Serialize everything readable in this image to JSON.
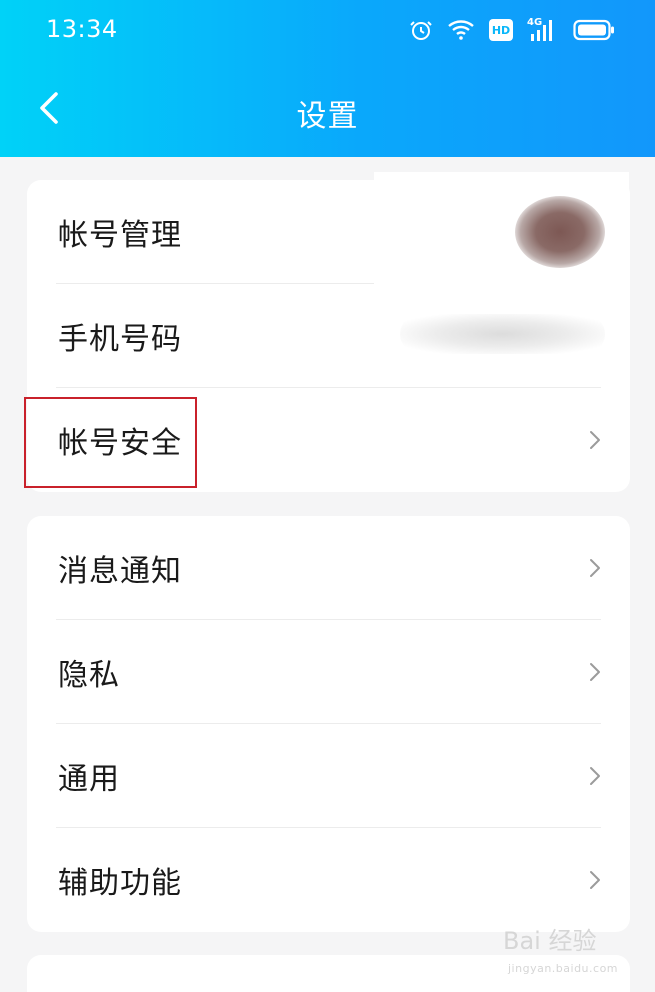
{
  "status_bar": {
    "time": "13:34",
    "hd_label": "HD",
    "network_label": "4G",
    "icons": [
      "alarm-icon",
      "wifi-icon",
      "hd-icon",
      "signal-icon",
      "battery-icon"
    ]
  },
  "header": {
    "title": "设置",
    "back_icon": "chevron-left-icon",
    "gradient_colors": [
      "#00d2f8",
      "#1297fb"
    ]
  },
  "sections": [
    {
      "items": [
        {
          "label": "帐号管理",
          "value": "",
          "has_avatar": true
        },
        {
          "label": "手机号码",
          "value": "",
          "has_chevron": true
        },
        {
          "label": "帐号安全",
          "value": "",
          "has_chevron": true,
          "highlighted": true
        }
      ]
    },
    {
      "items": [
        {
          "label": "消息通知",
          "has_chevron": true
        },
        {
          "label": "隐私",
          "has_chevron": true
        },
        {
          "label": "通用",
          "has_chevron": true
        },
        {
          "label": "辅助功能",
          "has_chevron": true
        }
      ]
    }
  ],
  "watermark": {
    "text": "Bai 经验",
    "subtext": "jingyan.baidu.com"
  },
  "colors": {
    "background": "#f5f5f6",
    "card": "#ffffff",
    "highlight": "#c9212b",
    "chevron": "#9b9b9b"
  }
}
